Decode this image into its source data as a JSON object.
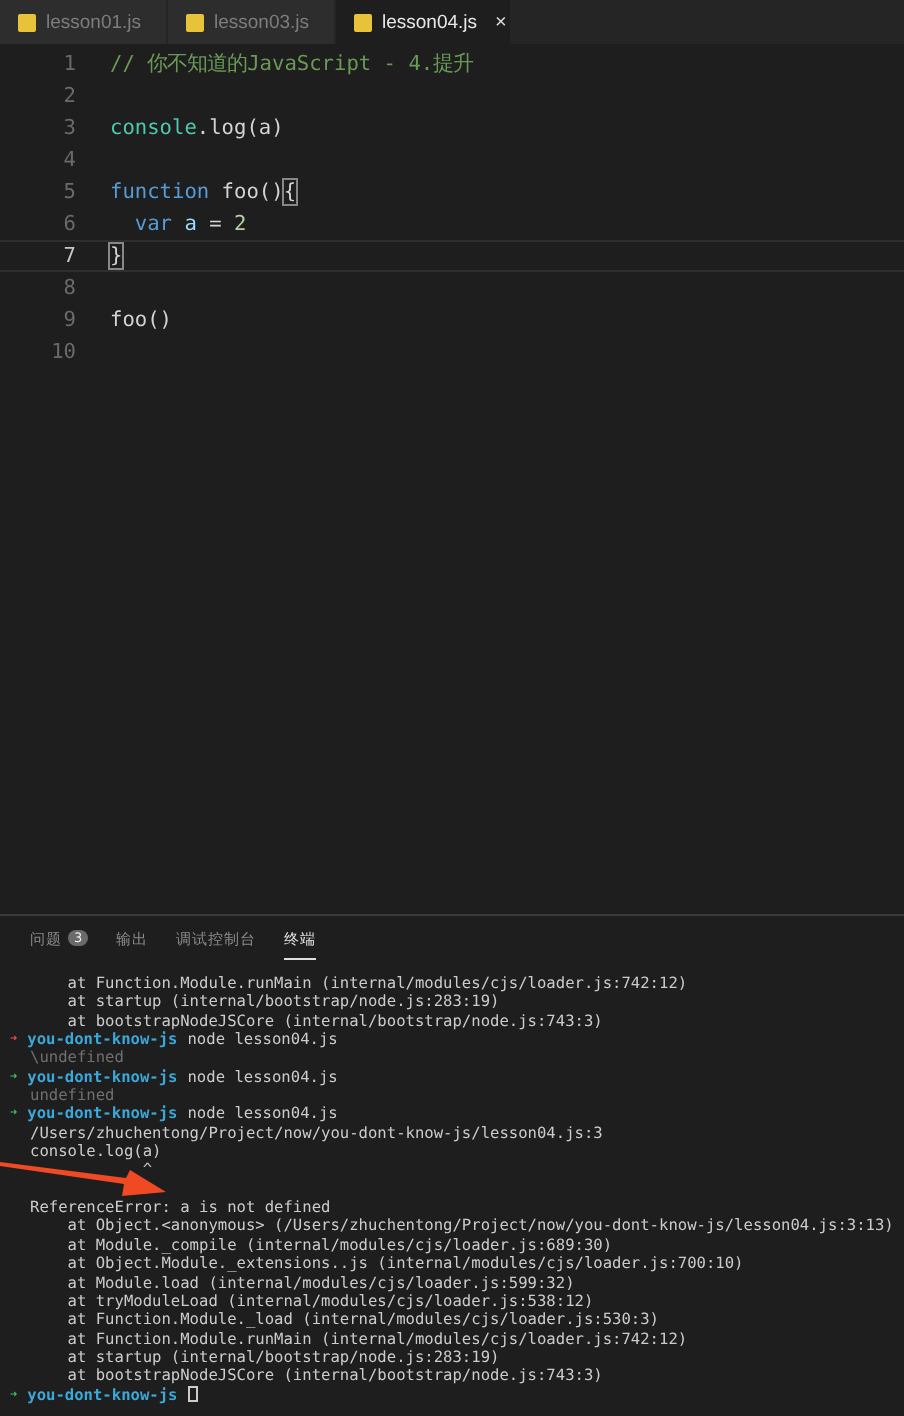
{
  "tabs": [
    {
      "label": "lesson01.js",
      "selected": false
    },
    {
      "label": "lesson03.js",
      "selected": false
    },
    {
      "label": "lesson04.js",
      "selected": true,
      "close": "×"
    }
  ],
  "editor": {
    "lines": [
      {
        "number": "1",
        "current": false,
        "tokens": [
          {
            "kind": "comment",
            "text": "// 你不知道的JavaScript - 4.提升"
          }
        ]
      },
      {
        "number": "2",
        "current": false
      },
      {
        "number": "3",
        "current": false,
        "tokens": [
          {
            "kind": "type",
            "text": "console"
          },
          {
            "kind": "plain",
            "text": ".log(a)"
          }
        ]
      },
      {
        "number": "4",
        "current": false
      },
      {
        "number": "5",
        "current": false,
        "tokens": [
          {
            "kind": "keyword",
            "text": "function"
          },
          {
            "kind": "plain",
            "text": " foo()"
          },
          {
            "kind": "bracket",
            "text": "{"
          }
        ]
      },
      {
        "number": "6",
        "current": false,
        "tokens": [
          {
            "kind": "keyword",
            "text": "  var"
          },
          {
            "kind": "variable",
            "text": " a"
          },
          {
            "kind": "plain",
            "text": " = "
          },
          {
            "kind": "number",
            "text": "2"
          }
        ]
      },
      {
        "number": "7",
        "current": true,
        "tokens": [
          {
            "kind": "bracket",
            "text": "}"
          }
        ]
      },
      {
        "number": "8",
        "current": false
      },
      {
        "number": "9",
        "current": false,
        "tokens": [
          {
            "kind": "plain",
            "text": "foo()"
          }
        ]
      },
      {
        "number": "10",
        "current": false
      }
    ]
  },
  "panel": {
    "tabs": [
      {
        "label": "问题",
        "badge": "3",
        "selected": false
      },
      {
        "label": "输出",
        "selected": false
      },
      {
        "label": "调试控制台",
        "selected": false
      },
      {
        "label": "终端",
        "selected": true
      }
    ]
  },
  "terminal": {
    "lines": [
      {
        "kind": "text",
        "text": "    at Function.Module.runMain (internal/modules/cjs/loader.js:742:12)"
      },
      {
        "kind": "text",
        "text": "    at startup (internal/bootstrap/node.js:283:19)"
      },
      {
        "kind": "text",
        "text": "    at bootstrapNodeJSCore (internal/bootstrap/node.js:743:3)"
      },
      {
        "kind": "prompt",
        "arrow": "➜",
        "color": "#e0524a",
        "dir": "you-dont-know-js",
        "command": "node lesson04.js"
      },
      {
        "kind": "muted",
        "text": "\\undefined"
      },
      {
        "kind": "prompt",
        "arrow": "➜",
        "color": "#3fbf6b",
        "dir": "you-dont-know-js",
        "command": "node lesson04.js"
      },
      {
        "kind": "muted",
        "text": "undefined"
      },
      {
        "kind": "prompt",
        "arrow": "➜",
        "color": "#3fbf6b",
        "dir": "you-dont-know-js",
        "command": "node lesson04.js"
      },
      {
        "kind": "text",
        "text": "/Users/zhuchentong/Project/now/you-dont-know-js/lesson04.js:3"
      },
      {
        "kind": "text",
        "text": "console.log(a)"
      },
      {
        "kind": "text",
        "text": "            ^"
      },
      {
        "kind": "blank"
      },
      {
        "kind": "text",
        "text": "ReferenceError: a is not defined"
      },
      {
        "kind": "text",
        "text": "    at Object.<anonymous> (/Users/zhuchentong/Project/now/you-dont-know-js/lesson04.js:3:13)"
      },
      {
        "kind": "text",
        "text": "    at Module._compile (internal/modules/cjs/loader.js:689:30)"
      },
      {
        "kind": "text",
        "text": "    at Object.Module._extensions..js (internal/modules/cjs/loader.js:700:10)"
      },
      {
        "kind": "text",
        "text": "    at Module.load (internal/modules/cjs/loader.js:599:32)"
      },
      {
        "kind": "text",
        "text": "    at tryModuleLoad (internal/modules/cjs/loader.js:538:12)"
      },
      {
        "kind": "text",
        "text": "    at Function.Module._load (internal/modules/cjs/loader.js:530:3)"
      },
      {
        "kind": "text",
        "text": "    at Function.Module.runMain (internal/modules/cjs/loader.js:742:12)"
      },
      {
        "kind": "text",
        "text": "    at startup (internal/bootstrap/node.js:283:19)"
      },
      {
        "kind": "text",
        "text": "    at bootstrapNodeJSCore (internal/bootstrap/node.js:743:3)"
      },
      {
        "kind": "prompt",
        "arrow": "➜",
        "color": "#3fbf6b",
        "dir": "you-dont-know-js",
        "cursor": true
      }
    ]
  }
}
